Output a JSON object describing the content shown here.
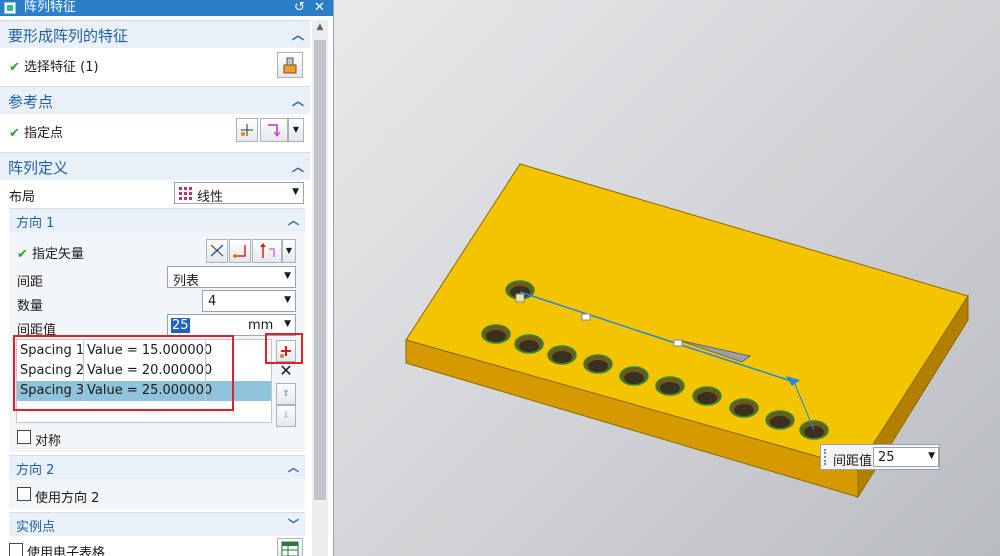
{
  "window": {
    "title": "阵列特征",
    "reset_icon": "↺",
    "close_icon": "✕"
  },
  "sections": {
    "features": {
      "title": "要形成阵列的特征",
      "select_label": "选择特征 (1)"
    },
    "reference": {
      "title": "参考点",
      "point_label": "指定点"
    },
    "pattern_def": {
      "title": "阵列定义",
      "layout_label": "布局",
      "layout_value": "线性",
      "direction1": {
        "title": "方向 1",
        "vector_label": "指定矢量",
        "spacing_label": "间距",
        "spacing_value": "列表",
        "count_label": "数量",
        "count_value": "4",
        "spacing_value_label": "间距值",
        "spacing_value_input": "25",
        "spacing_value_unit": "mm",
        "list": [
          {
            "name": "Spacing 1",
            "value": "Value = 15.000000"
          },
          {
            "name": "Spacing 2",
            "value": "Value = 20.000000"
          },
          {
            "name": "Spacing 3",
            "value": "Value = 25.000000"
          }
        ],
        "symmetric_label": "对称"
      },
      "direction2": {
        "title": "方向 2",
        "use_label": "使用方向 2"
      },
      "instance": {
        "title": "实例点",
        "spreadsheet_label": "使用电子表格"
      }
    }
  },
  "viewport": {
    "tooltip_label": "间距值",
    "tooltip_value": "25",
    "plate_color": "#f5c400",
    "plate_side_color": "#d49a00"
  },
  "colors": {
    "accent": "#1f5fa8",
    "title_bar": "#2b7fc8",
    "highlight": "#e0202a",
    "selection": "#8fc3dc"
  }
}
